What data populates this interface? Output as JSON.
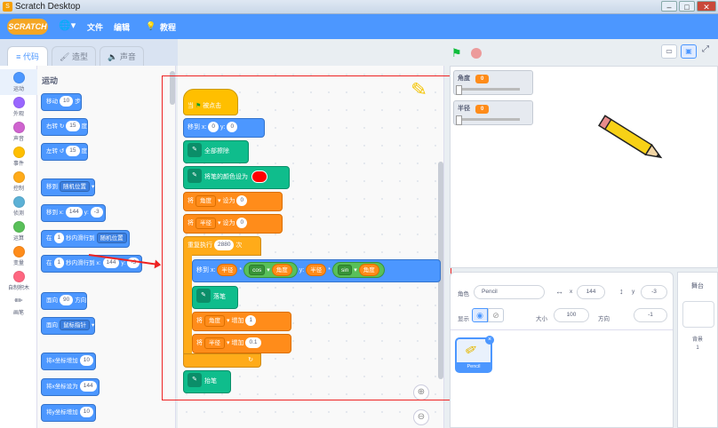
{
  "window": {
    "title": "Scratch Desktop"
  },
  "menubar": {
    "logo": "SCRATCH",
    "file": "文件",
    "edit": "编辑",
    "tutorials": "教程"
  },
  "tabs": {
    "code": "代码",
    "costumes": "造型",
    "sounds": "声音"
  },
  "categories": [
    {
      "label": "运动",
      "color": "#4c97ff"
    },
    {
      "label": "外观",
      "color": "#9966ff"
    },
    {
      "label": "声音",
      "color": "#cf63cf"
    },
    {
      "label": "事件",
      "color": "#ffbf00"
    },
    {
      "label": "控制",
      "color": "#ffab19"
    },
    {
      "label": "侦测",
      "color": "#5cb1d6"
    },
    {
      "label": "运算",
      "color": "#59c059"
    },
    {
      "label": "变量",
      "color": "#ff8c1a"
    },
    {
      "label": "自制积木",
      "color": "#ff6680"
    },
    {
      "label": "画笔",
      "color": "#0fbd8c"
    }
  ],
  "palette": {
    "title": "运动",
    "move": {
      "a": "移动",
      "v": "10",
      "b": "步"
    },
    "turn_right": {
      "a": "右转",
      "v": "15",
      "b": "度"
    },
    "turn_left": {
      "a": "左转",
      "v": "15",
      "b": "度"
    },
    "goto": {
      "a": "移到",
      "dd": "随机位置"
    },
    "goto_xy": {
      "a": "移到 x:",
      "x": "144",
      "b": "y:",
      "y": "-3"
    },
    "glide": {
      "a": "在",
      "v": "1",
      "b": "秒内滑行到",
      "dd": "随机位置"
    },
    "glide_xy": {
      "a": "在",
      "v": "1",
      "b": "秒内滑行到 x:",
      "x": "144",
      "c": "y:",
      "y": "-3"
    },
    "point_dir": {
      "a": "面向",
      "v": "90",
      "b": "方向"
    },
    "point_towards": {
      "a": "面向",
      "dd": "鼠标指针"
    },
    "change_x": {
      "a": "将x坐标增加",
      "v": "10"
    },
    "set_x": {
      "a": "将x坐标设为",
      "v": "144"
    },
    "change_y": {
      "a": "将y坐标增加",
      "v": "10"
    }
  },
  "script": {
    "when_flag": {
      "a": "当",
      "b": "被点击"
    },
    "goto_xy": {
      "a": "移到 x:",
      "x": "0",
      "b": "y:",
      "y": "0"
    },
    "clear": "全部擦除",
    "set_pen_color": "将笔的颜色设为",
    "set_angle": {
      "a": "将",
      "var": "角度",
      "b": "设为",
      "v": "0"
    },
    "set_radius": {
      "a": "将",
      "var": "半径",
      "b": "设为",
      "v": "0"
    },
    "repeat": {
      "a": "重复执行",
      "v": "2880",
      "b": "次"
    },
    "goto_expr": {
      "a": "移到 x:",
      "r1": "半径",
      "mul": "*",
      "fn1": "cos",
      "a1": "角度",
      "b": "y:",
      "r2": "半径",
      "fn2": "sin",
      "a2": "角度"
    },
    "pen_down": "落笔",
    "change_angle": {
      "a": "将",
      "var": "角度",
      "b": "增加",
      "v": "1"
    },
    "change_radius": {
      "a": "将",
      "var": "半径",
      "b": "增加",
      "v": "0.1"
    },
    "pen_up": "抬笔"
  },
  "monitors": [
    {
      "label": "角度",
      "value": "0"
    },
    {
      "label": "半径",
      "value": "0"
    }
  ],
  "sprite_info": {
    "sprite_label": "角色",
    "sprite_name": "Pencil",
    "x_label": "x",
    "x": "144",
    "y_label": "y",
    "y": "-3",
    "show_label": "显示",
    "size_label": "大小",
    "size": "100",
    "dir_label": "方向",
    "dir": "-1"
  },
  "sprites": [
    {
      "name": "Pencil"
    }
  ],
  "stage_panel": {
    "title": "舞台",
    "backdrops_label": "背景",
    "backdrops_count": "1"
  },
  "colors": {
    "accent": "#4c97ff",
    "pen_color": "#ff0000",
    "highlight_box": "#ee2222"
  }
}
